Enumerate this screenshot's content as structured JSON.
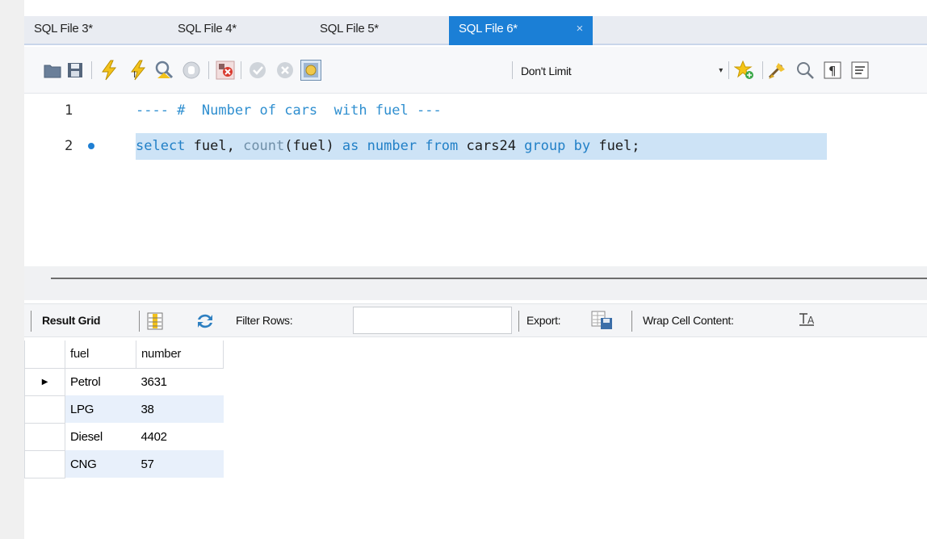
{
  "tabs": [
    {
      "label": "SQL File 3*",
      "active": false
    },
    {
      "label": "SQL File 4*",
      "active": false
    },
    {
      "label": "SQL File 5*",
      "active": false
    },
    {
      "label": "SQL File 6*",
      "active": true
    }
  ],
  "tab_close_glyph": "×",
  "toolbar": {
    "icons": [
      "open-folder-icon",
      "save-icon",
      "execute-icon",
      "execute-current-icon",
      "explain-icon",
      "stop-icon",
      "toggle-error-icon",
      "commit-icon",
      "rollback-icon",
      "autocommit-icon",
      "bookmark-icon",
      "beautify-icon",
      "find-icon",
      "invisible-chars-icon",
      "wrap-icon"
    ],
    "limit_label": "Don't Limit",
    "limit_arrow": "▾"
  },
  "editor": {
    "lines": [
      {
        "number": "1",
        "text": "---- #  Number of cars  with fuel ---"
      },
      {
        "number": "2",
        "text": "select fuel, count(fuel) as number from cars24 group by fuel;"
      }
    ],
    "line2_tokens": {
      "t1": "select",
      "t2": " fuel, ",
      "t3": "count",
      "t4": "(fuel) ",
      "t5": "as",
      "t6": " ",
      "t7": "number",
      "t8": " ",
      "t9": "from",
      "t10": " cars24 ",
      "t11": "group",
      "t12": " ",
      "t13": "by",
      "t14": " fuel;"
    }
  },
  "result_toolbar": {
    "result_grid_label": "Result Grid",
    "filter_label": "Filter Rows:",
    "filter_value": "",
    "export_label": "Export:",
    "wrap_label": "Wrap Cell Content:"
  },
  "grid": {
    "columns": [
      "fuel",
      "number"
    ],
    "current_row_marker": "▶",
    "rows": [
      {
        "fuel": "Petrol",
        "number": "3631"
      },
      {
        "fuel": "LPG",
        "number": "38"
      },
      {
        "fuel": "Diesel",
        "number": "4402"
      },
      {
        "fuel": "CNG",
        "number": "57"
      }
    ]
  },
  "colors": {
    "active_tab": "#1b7fd6",
    "keyword": "#2280c7",
    "selection": "#cde3f6",
    "alt_row": "#e8f0fb"
  }
}
